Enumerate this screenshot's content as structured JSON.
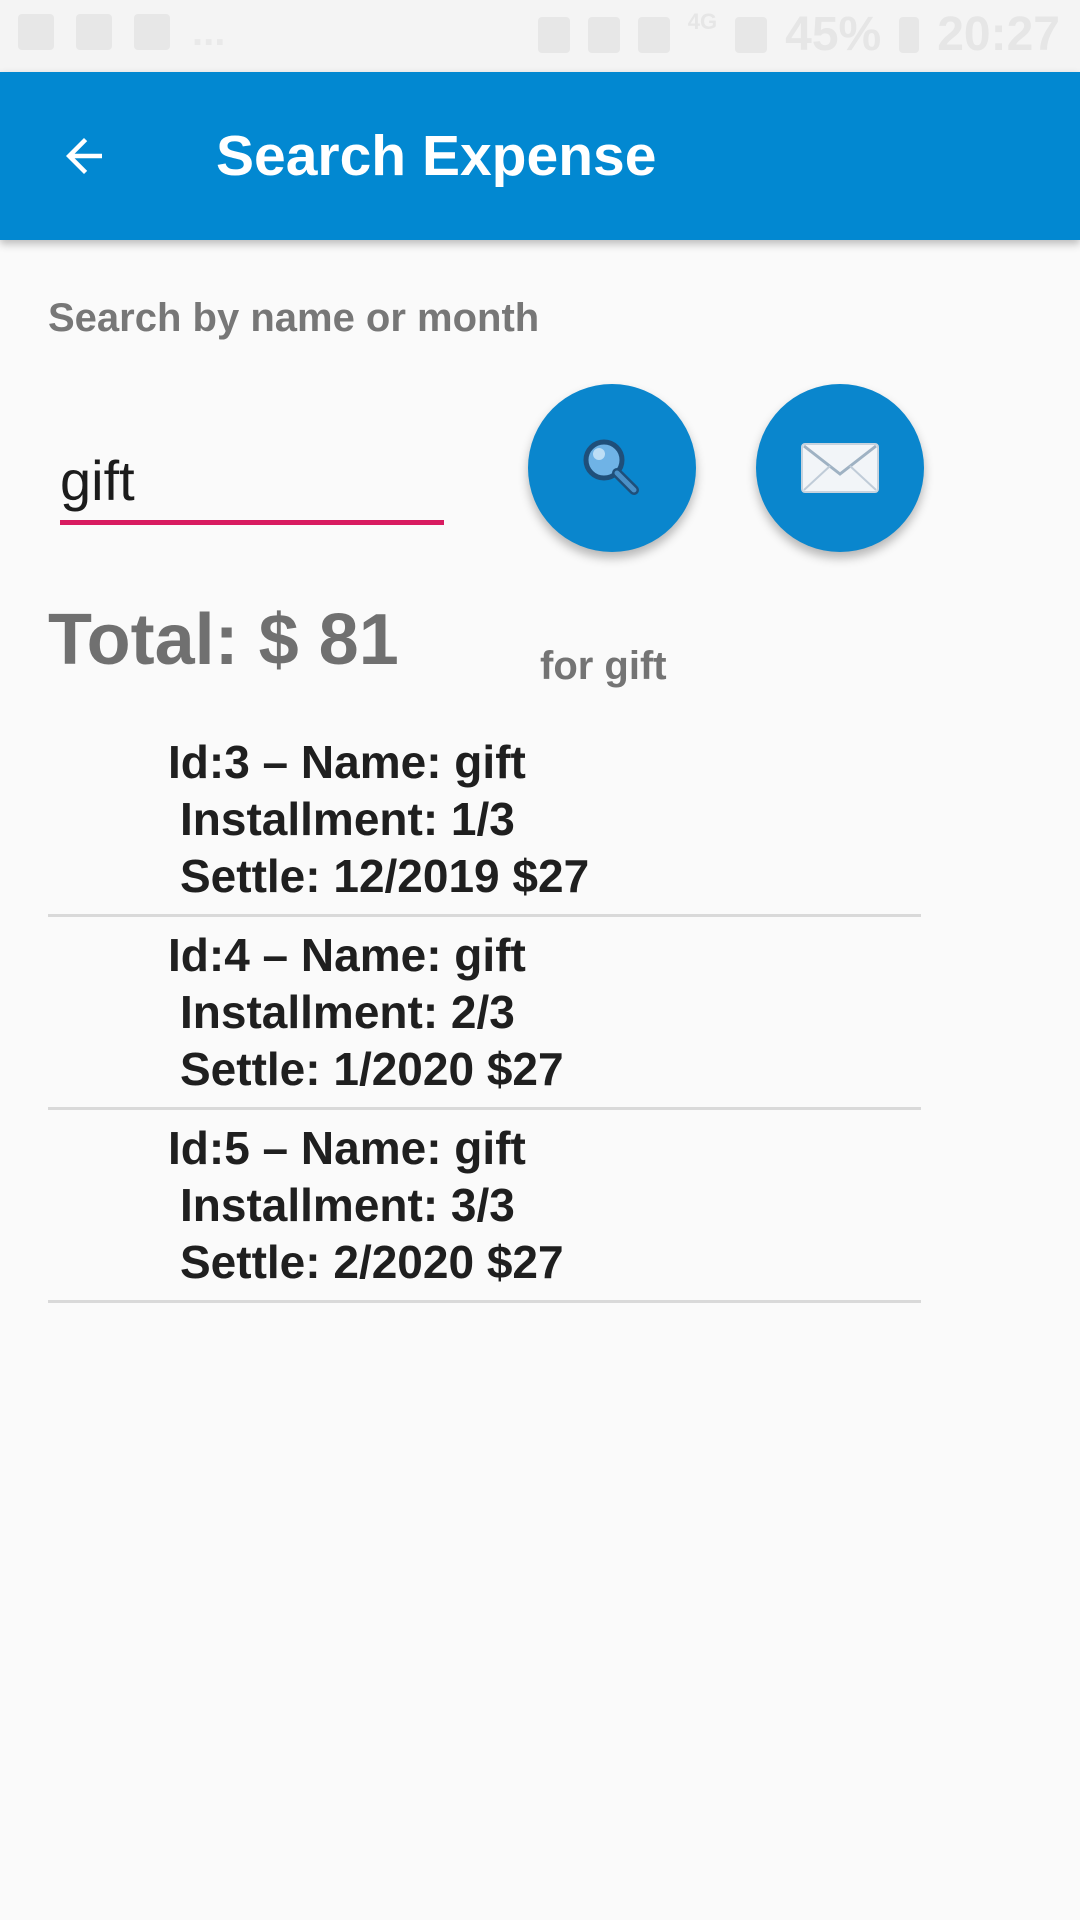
{
  "status_bar": {
    "battery": "45%",
    "time": "20:27",
    "network": "4G",
    "left_overflow": "..."
  },
  "app_bar": {
    "title": "Search Expense",
    "back_icon": "arrow-left-icon"
  },
  "search": {
    "hint_label": "Search by name or month",
    "input_value": "gift",
    "search_icon": "magnifier-icon",
    "email_icon": "envelope-icon"
  },
  "summary": {
    "total_text": "Total: $ 81",
    "for_text": "for  gift"
  },
  "results": [
    {
      "line1": "Id:3 – Name: gift",
      "line2": "Installment: 1/3",
      "line3": "Settle: 12/2019 $27"
    },
    {
      "line1": "Id:4 – Name: gift",
      "line2": "Installment: 2/3",
      "line3": "Settle: 1/2020 $27"
    },
    {
      "line1": "Id:5 – Name: gift",
      "line2": "Installment: 3/3",
      "line3": "Settle: 2/2020 $27"
    }
  ],
  "colors": {
    "app_bar": "#0288d1",
    "fab": "#0a86cd",
    "input_underline": "#d81b60",
    "background": "#fafafa"
  }
}
